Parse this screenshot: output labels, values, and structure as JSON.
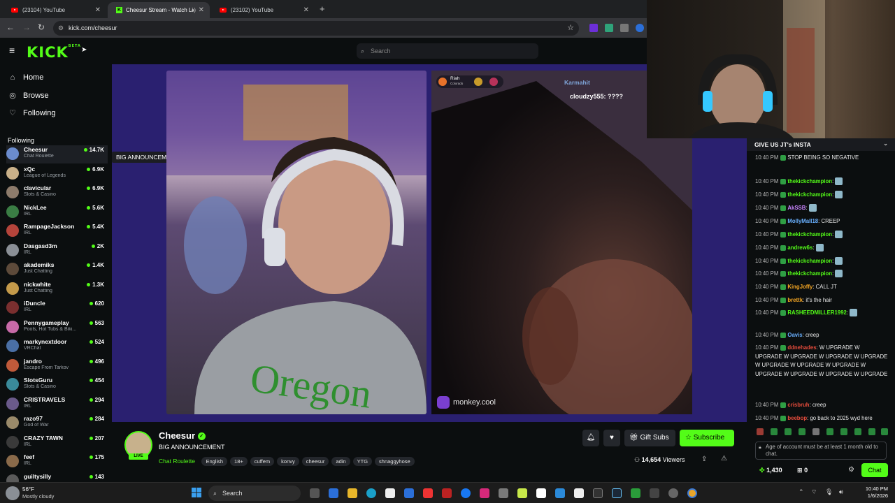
{
  "browser": {
    "tabs": [
      {
        "label": "(23104) YouTube",
        "icon": "youtube-icon"
      },
      {
        "label": "Cheesur Stream - Watch Li",
        "icon": "kick-icon"
      },
      {
        "label": "(23102) YouTube",
        "icon": "youtube-icon"
      }
    ],
    "url": "kick.com/cheesur"
  },
  "kick": {
    "logo": "KICK",
    "logo_badge": "BETA",
    "search_placeholder": "Search",
    "nav": [
      {
        "label": "Home",
        "icon": "home-icon"
      },
      {
        "label": "Browse",
        "icon": "compass-icon"
      },
      {
        "label": "Following",
        "icon": "heart-icon"
      }
    ],
    "following_header": "Following",
    "tooltip": "BIG ANNOUNCEMENT",
    "following": [
      {
        "name": "Cheesur",
        "category": "Chat Roulette",
        "viewers": "14.7K",
        "color": "#6b8cce"
      },
      {
        "name": "xQc",
        "category": "League of Legends",
        "viewers": "6.9K",
        "color": "#c9b089"
      },
      {
        "name": "clavicular",
        "category": "Slots & Casino",
        "viewers": "6.9K",
        "color": "#8d7b6b"
      },
      {
        "name": "NickLee",
        "category": "IRL",
        "viewers": "5.6K",
        "color": "#3a7d44"
      },
      {
        "name": "RampageJackson",
        "category": "IRL",
        "viewers": "5.4K",
        "color": "#b5443b"
      },
      {
        "name": "Dasgasd3m",
        "category": "IRL",
        "viewers": "2K",
        "color": "#8a8f96"
      },
      {
        "name": "akademiks",
        "category": "Just Chatting",
        "viewers": "1.4K",
        "color": "#5d4a3a"
      },
      {
        "name": "nickwhite",
        "category": "Just Chatting",
        "viewers": "1.3K",
        "color": "#c49a4a"
      },
      {
        "name": "iDuncle",
        "category": "IRL",
        "viewers": "620",
        "color": "#7a2f2f"
      },
      {
        "name": "Pennygameplay",
        "category": "Pools, Hot Tubs & Biki...",
        "viewers": "563",
        "color": "#c76aa8"
      },
      {
        "name": "markynextdoor",
        "category": "VRChat",
        "viewers": "524",
        "color": "#4a6fa5"
      },
      {
        "name": "jandro",
        "category": "Escape From Tarkov",
        "viewers": "496",
        "color": "#c05a3a"
      },
      {
        "name": "SlotsGuru",
        "category": "Slots & Casino",
        "viewers": "454",
        "color": "#3a8a9a"
      },
      {
        "name": "CRISTRAVELS",
        "category": "IRL",
        "viewers": "294",
        "color": "#6a5a8a"
      },
      {
        "name": "razo97",
        "category": "God of War",
        "viewers": "284",
        "color": "#9a8a6a"
      },
      {
        "name": "CRAZY TAWN",
        "category": "IRL",
        "viewers": "207",
        "color": "#3a3a3a"
      },
      {
        "name": "feef",
        "category": "IRL",
        "viewers": "175",
        "color": "#8a6a4a"
      },
      {
        "name": "guiltysilly",
        "category": "",
        "viewers": "143",
        "color": "#5a5a5a"
      }
    ]
  },
  "stream": {
    "overlay_user": "Riah",
    "overlay_location": "Colorado",
    "overlay_chat": [
      {
        "user": "Karmahit",
        "text": ""
      },
      {
        "user": "cloudzy555",
        "text": "????"
      }
    ],
    "watermark": "monkey.cool"
  },
  "channel": {
    "name": "Cheesur",
    "live_label": "LIVE",
    "title": "BIG ANNOUNCEMENT",
    "category": "Chat Roulette",
    "tags": [
      "English",
      "18+",
      "cuffem",
      "konvy",
      "cheesur",
      "adin",
      "YTG",
      "shnaggyhose"
    ],
    "gift_label": "Gift Subs",
    "subscribe_label": "Subscribe",
    "viewers": "14,654",
    "viewers_label": "Viewers"
  },
  "chat": {
    "pinned": "GIVE US JT's INSTA",
    "messages": [
      {
        "time": "10:40 PM",
        "user": "",
        "text": "STOP BEING SO NEGATIVE",
        "color": "#c0392b"
      },
      {
        "time": "10:40 PM",
        "user": "thekickchampion",
        "text": "",
        "color": "#53fc18"
      },
      {
        "time": "10:40 PM",
        "user": "thekickchampion",
        "text": "",
        "color": "#53fc18"
      },
      {
        "time": "10:40 PM",
        "user": "AkSSB",
        "text": "",
        "color": "#c985ff"
      },
      {
        "time": "10:40 PM",
        "user": "MollyMall18",
        "text": "CREEP",
        "color": "#69b0ff"
      },
      {
        "time": "10:40 PM",
        "user": "thekickchampion",
        "text": "",
        "color": "#53fc18"
      },
      {
        "time": "10:40 PM",
        "user": "andrew6s",
        "text": "",
        "color": "#53fc18"
      },
      {
        "time": "10:40 PM",
        "user": "thekickchampion",
        "text": "",
        "color": "#53fc18"
      },
      {
        "time": "10:40 PM",
        "user": "thekickchampion",
        "text": "",
        "color": "#53fc18"
      },
      {
        "time": "10:40 PM",
        "user": "KingJoffy",
        "text": "CALL JT",
        "color": "#f5a623"
      },
      {
        "time": "10:40 PM",
        "user": "brettk",
        "text": "it's the hair",
        "color": "#f5a623"
      },
      {
        "time": "10:40 PM",
        "user": "RASHEEDMILLER1992",
        "text": "",
        "color": "#53fc18"
      },
      {
        "time": "10:40 PM",
        "user": "Oavis",
        "text": "creep",
        "color": "#69b0ff"
      },
      {
        "time": "10:40 PM",
        "user": "ddnehades",
        "text": "W UPGRADE W UPGRADE W UPGRADE W UPGRADE W UPGRADE W UPGRADE W UPGRADE W UPGRADE W UPGRADE W UPGRADE W UPGRADE W UPGRADE",
        "color": "#e74c3c"
      },
      {
        "time": "10:40 PM",
        "user": "crisbruh",
        "text": "creep",
        "color": "#e74c3c"
      },
      {
        "time": "10:40 PM",
        "user": "beebop",
        "text": "go back to 2025 wyd here",
        "color": "#e74c3c"
      }
    ],
    "input_placeholder": "Age of account must be at least 1 month old to chat.",
    "points": "1,430",
    "boxes": "0",
    "chat_button": "Chat"
  },
  "taskbar": {
    "weather_temp": "56°F",
    "weather_desc": "Mostly cloudy",
    "search_label": "Search",
    "time": "10:40 PM",
    "date": "1/6/2026"
  }
}
